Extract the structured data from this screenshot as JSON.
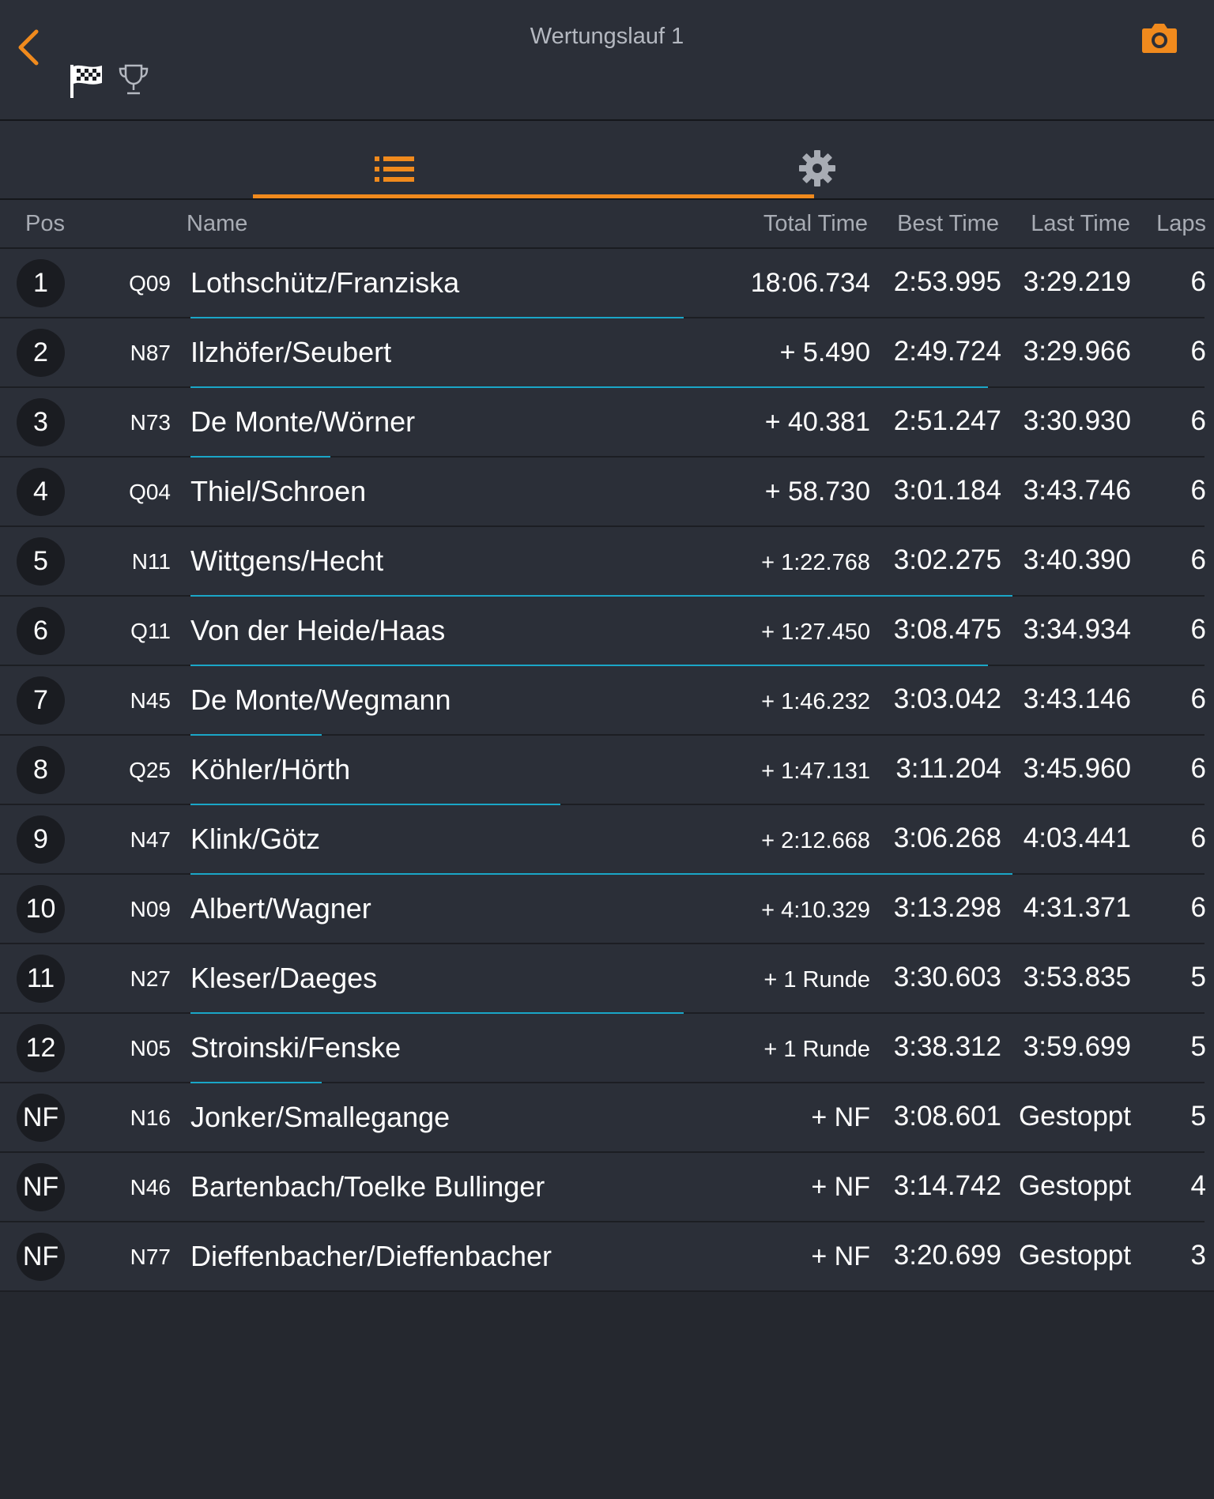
{
  "header": {
    "title": "Wertungslauf 1"
  },
  "columns": {
    "pos": "Pos",
    "name": "Name",
    "total": "Total Time",
    "best": "Best Time",
    "last": "Last Time",
    "laps": "Laps"
  },
  "colors": {
    "accent": "#f08a1d",
    "progress": "#1aa6c7"
  },
  "rows": [
    {
      "pos": "1",
      "num": "Q09",
      "name": "Lothschütz/Franziska",
      "total": "18:06.734",
      "best": "2:53.995",
      "last": "3:29.219",
      "laps": "6",
      "bar": 0.6
    },
    {
      "pos": "2",
      "num": "N87",
      "name": "Ilzhöfer/Seubert",
      "total": "+ 5.490",
      "best": "2:49.724",
      "last": "3:29.966",
      "laps": "6",
      "bar": 0.97
    },
    {
      "pos": "3",
      "num": "N73",
      "name": "De Monte/Wörner",
      "total": "+ 40.381",
      "best": "2:51.247",
      "last": "3:30.930",
      "laps": "6",
      "bar": 0.17
    },
    {
      "pos": "4",
      "num": "Q04",
      "name": "Thiel/Schroen",
      "total": "+ 58.730",
      "best": "3:01.184",
      "last": "3:43.746",
      "laps": "6",
      "bar": 0
    },
    {
      "pos": "5",
      "num": "N11",
      "name": "Wittgens/Hecht",
      "total": "+ 1:22.768",
      "best": "3:02.275",
      "last": "3:40.390",
      "laps": "6",
      "bar": 1.0
    },
    {
      "pos": "6",
      "num": "Q11",
      "name": "Von der Heide/Haas",
      "total": "+ 1:27.450",
      "best": "3:08.475",
      "last": "3:34.934",
      "laps": "6",
      "bar": 0.97
    },
    {
      "pos": "7",
      "num": "N45",
      "name": "De Monte/Wegmann",
      "total": "+ 1:46.232",
      "best": "3:03.042",
      "last": "3:43.146",
      "laps": "6",
      "bar": 0.16
    },
    {
      "pos": "8",
      "num": "Q25",
      "name": "Köhler/Hörth",
      "total": "+ 1:47.131",
      "best": "3:11.204",
      "last": "3:45.960",
      "laps": "6",
      "bar": 0.45
    },
    {
      "pos": "9",
      "num": "N47",
      "name": "Klink/Götz",
      "total": "+ 2:12.668",
      "best": "3:06.268",
      "last": "4:03.441",
      "laps": "6",
      "bar": 1.0
    },
    {
      "pos": "10",
      "num": "N09",
      "name": "Albert/Wagner",
      "total": "+ 4:10.329",
      "best": "3:13.298",
      "last": "4:31.371",
      "laps": "6",
      "bar": 0
    },
    {
      "pos": "11",
      "num": "N27",
      "name": "Kleser/Daeges",
      "total": "+ 1 Runde",
      "best": "3:30.603",
      "last": "3:53.835",
      "laps": "5",
      "bar": 0.6
    },
    {
      "pos": "12",
      "num": "N05",
      "name": "Stroinski/Fenske",
      "total": "+ 1 Runde",
      "best": "3:38.312",
      "last": "3:59.699",
      "laps": "5",
      "bar": 0.16
    },
    {
      "pos": "NF",
      "num": "N16",
      "name": "Jonker/Smallegange",
      "total": "+ NF",
      "best": "3:08.601",
      "last": "Gestoppt",
      "laps": "5",
      "bar": 0
    },
    {
      "pos": "NF",
      "num": "N46",
      "name": "Bartenbach/Toelke Bullinger",
      "total": "+ NF",
      "best": "3:14.742",
      "last": "Gestoppt",
      "laps": "4",
      "bar": 0
    },
    {
      "pos": "NF",
      "num": "N77",
      "name": "Dieffenbacher/Dieffenbacher",
      "total": "+ NF",
      "best": "3:20.699",
      "last": "Gestoppt",
      "laps": "3",
      "bar": 0
    }
  ]
}
